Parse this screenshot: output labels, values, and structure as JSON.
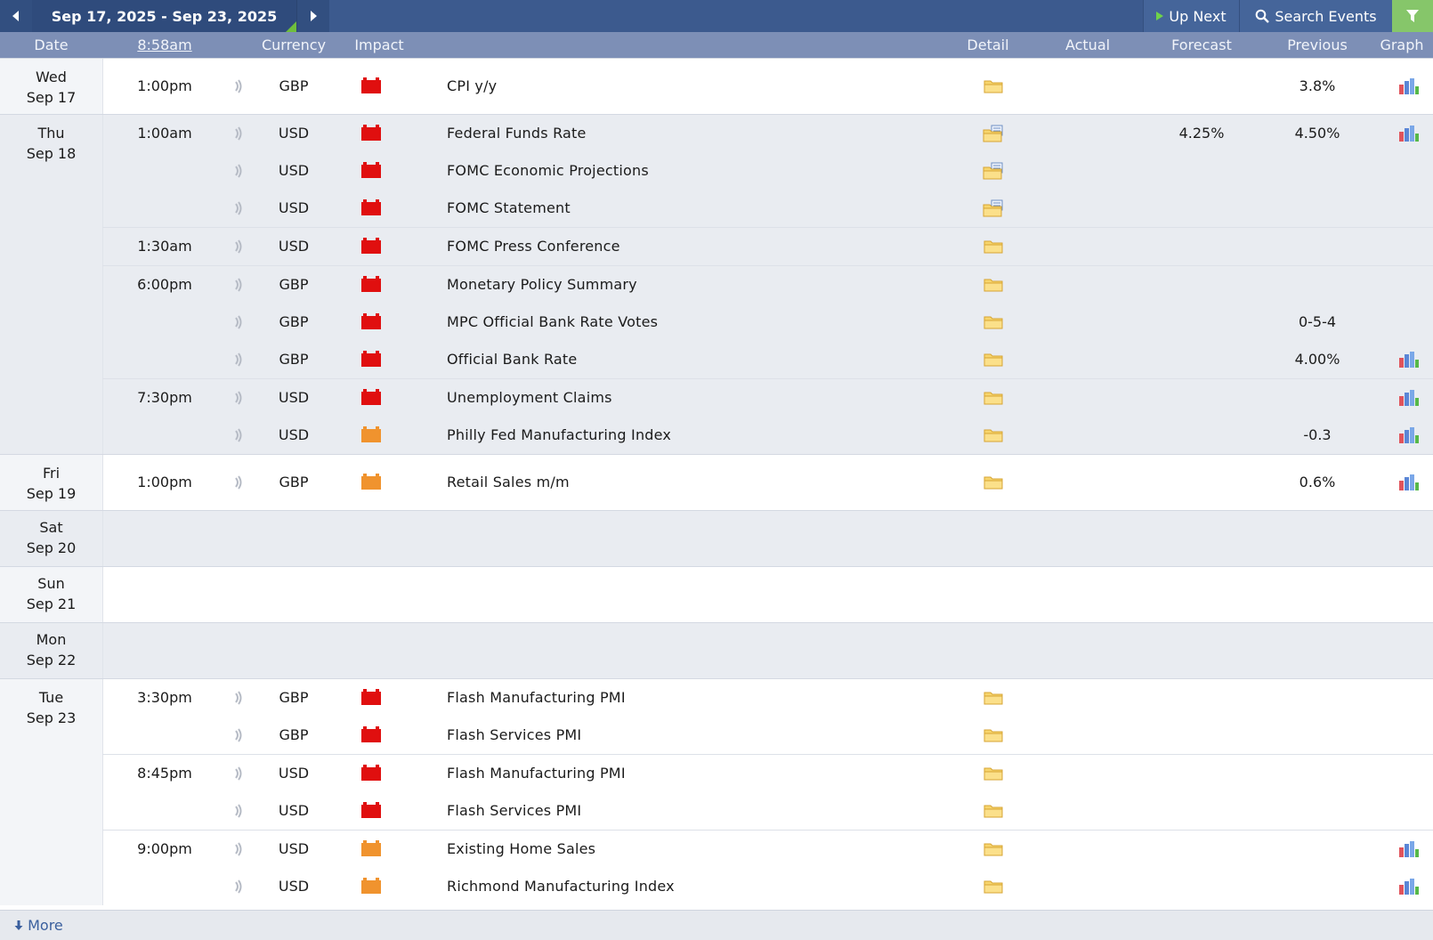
{
  "toolbar": {
    "range": "Sep 17, 2025 - Sep 23, 2025",
    "up_next": "Up Next",
    "search": "Search Events"
  },
  "header": {
    "date": "Date",
    "time": "8:58am",
    "currency": "Currency",
    "impact": "Impact",
    "detail": "Detail",
    "actual": "Actual",
    "forecast": "Forecast",
    "previous": "Previous",
    "graph": "Graph"
  },
  "days": [
    {
      "weekday": "Wed",
      "date": "Sep 17",
      "events": [
        {
          "time": "1:00pm",
          "currency": "GBP",
          "impact": "high",
          "event": "CPI y/y",
          "actual": "",
          "forecast": "",
          "previous": "3.8%",
          "graph": true
        }
      ]
    },
    {
      "weekday": "Thu",
      "date": "Sep 18",
      "events": [
        {
          "time": "1:00am",
          "currency": "USD",
          "impact": "high",
          "event": "Federal Funds Rate",
          "actual": "",
          "forecast": "4.25%",
          "previous": "4.50%",
          "graph": true
        },
        {
          "time": "",
          "currency": "USD",
          "impact": "high",
          "event": "FOMC Economic Projections",
          "actual": "",
          "forecast": "",
          "previous": "",
          "graph": false
        },
        {
          "time": "",
          "currency": "USD",
          "impact": "high",
          "event": "FOMC Statement",
          "actual": "",
          "forecast": "",
          "previous": "",
          "graph": false
        },
        {
          "time": "1:30am",
          "currency": "USD",
          "impact": "high",
          "event": "FOMC Press Conference",
          "actual": "",
          "forecast": "",
          "previous": "",
          "graph": false
        },
        {
          "time": "6:00pm",
          "currency": "GBP",
          "impact": "high",
          "event": "Monetary Policy Summary",
          "actual": "",
          "forecast": "",
          "previous": "",
          "graph": false
        },
        {
          "time": "",
          "currency": "GBP",
          "impact": "high",
          "event": "MPC Official Bank Rate Votes",
          "actual": "",
          "forecast": "",
          "previous": "0-5-4",
          "graph": false
        },
        {
          "time": "",
          "currency": "GBP",
          "impact": "high",
          "event": "Official Bank Rate",
          "actual": "",
          "forecast": "",
          "previous": "4.00%",
          "graph": true
        },
        {
          "time": "7:30pm",
          "currency": "USD",
          "impact": "high",
          "event": "Unemployment Claims",
          "actual": "",
          "forecast": "",
          "previous": "",
          "graph": true
        },
        {
          "time": "",
          "currency": "USD",
          "impact": "medium",
          "event": "Philly Fed Manufacturing Index",
          "actual": "",
          "forecast": "",
          "previous": "-0.3",
          "graph": true
        }
      ]
    },
    {
      "weekday": "Fri",
      "date": "Sep 19",
      "events": [
        {
          "time": "1:00pm",
          "currency": "GBP",
          "impact": "medium",
          "event": "Retail Sales m/m",
          "actual": "",
          "forecast": "",
          "previous": "0.6%",
          "graph": true
        }
      ]
    },
    {
      "weekday": "Sat",
      "date": "Sep 20",
      "events": []
    },
    {
      "weekday": "Sun",
      "date": "Sep 21",
      "events": []
    },
    {
      "weekday": "Mon",
      "date": "Sep 22",
      "events": []
    },
    {
      "weekday": "Tue",
      "date": "Sep 23",
      "events": [
        {
          "time": "3:30pm",
          "currency": "GBP",
          "impact": "high",
          "event": "Flash Manufacturing PMI",
          "actual": "",
          "forecast": "",
          "previous": "",
          "graph": false
        },
        {
          "time": "",
          "currency": "GBP",
          "impact": "high",
          "event": "Flash Services PMI",
          "actual": "",
          "forecast": "",
          "previous": "",
          "graph": false
        },
        {
          "time": "8:45pm",
          "currency": "USD",
          "impact": "high",
          "event": "Flash Manufacturing PMI",
          "actual": "",
          "forecast": "",
          "previous": "",
          "graph": false
        },
        {
          "time": "",
          "currency": "USD",
          "impact": "high",
          "event": "Flash Services PMI",
          "actual": "",
          "forecast": "",
          "previous": "",
          "graph": false
        },
        {
          "time": "9:00pm",
          "currency": "USD",
          "impact": "medium",
          "event": "Existing Home Sales",
          "actual": "",
          "forecast": "",
          "previous": "",
          "graph": true
        },
        {
          "time": "",
          "currency": "USD",
          "impact": "medium",
          "event": "Richmond Manufacturing Index",
          "actual": "",
          "forecast": "",
          "previous": "",
          "graph": true
        }
      ]
    }
  ],
  "colors": {
    "impact_high": "#e00f0f",
    "impact_medium": "#f0932e",
    "topbar": "#3c5a8e",
    "header": "#7d8fb6"
  },
  "footer": {
    "more": "More"
  }
}
